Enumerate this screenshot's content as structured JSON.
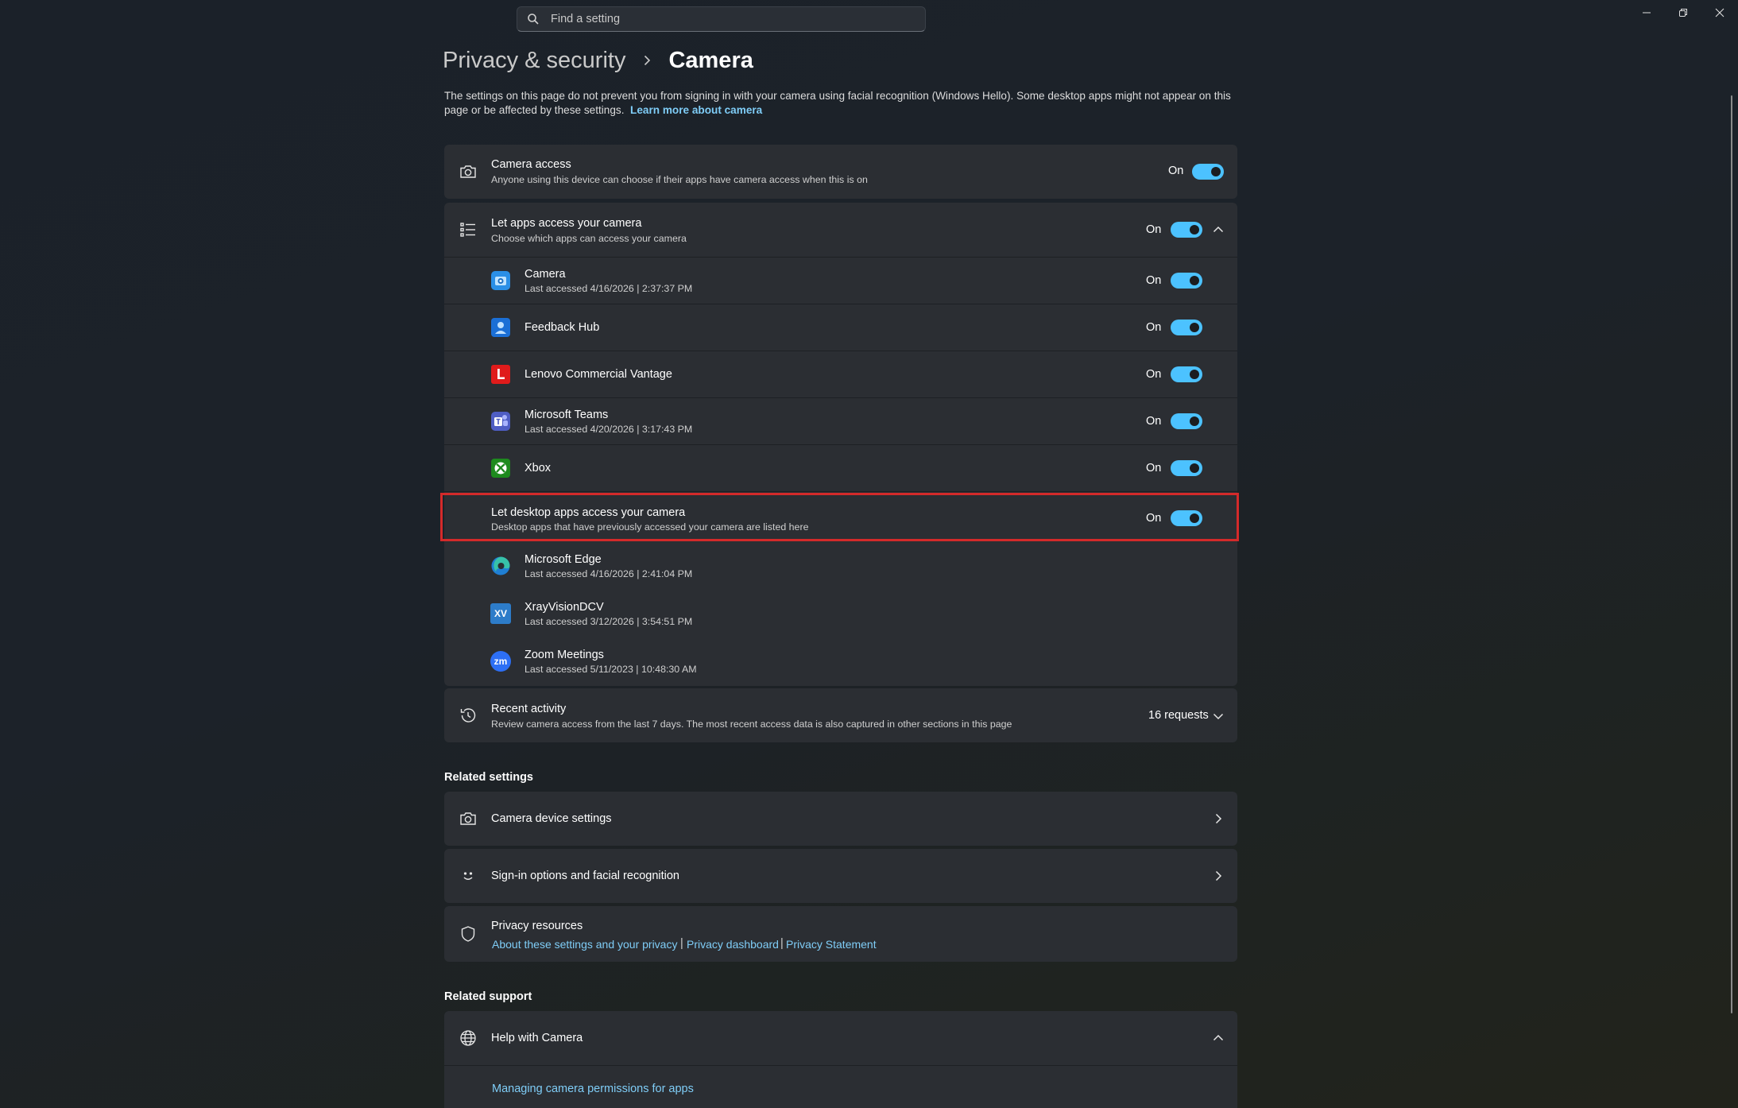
{
  "search": {
    "placeholder": "Find a setting"
  },
  "breadcrumb": {
    "parent": "Privacy & security",
    "current": "Camera"
  },
  "intro": {
    "text": "The settings on this page do not prevent you from signing in with your camera using facial recognition (Windows Hello). Some desktop apps might not appear on this page or be affected by these settings.",
    "link": "Learn more about camera"
  },
  "camera_access": {
    "title": "Camera access",
    "description": "Anyone using this device can choose if their apps have camera access when this is on",
    "state": "On"
  },
  "let_apps": {
    "title": "Let apps access your camera",
    "description": "Choose which apps can access your camera",
    "state": "On",
    "apps": [
      {
        "name": "Camera",
        "last": "Last accessed 4/16/2026  |  2:37:37 PM",
        "state": "On",
        "icon": "camera-app-icon"
      },
      {
        "name": "Feedback Hub",
        "last": "",
        "state": "On",
        "icon": "feedback-hub-icon"
      },
      {
        "name": "Lenovo Commercial Vantage",
        "last": "",
        "state": "On",
        "icon": "lenovo-vantage-icon"
      },
      {
        "name": "Microsoft Teams",
        "last": "Last accessed 4/20/2026  |  3:17:43 PM",
        "state": "On",
        "icon": "teams-icon"
      },
      {
        "name": "Xbox",
        "last": "",
        "state": "On",
        "icon": "xbox-icon"
      }
    ]
  },
  "desktop_apps": {
    "title": "Let desktop apps access your camera",
    "description": "Desktop apps that have previously accessed your camera are listed here",
    "state": "On",
    "apps": [
      {
        "name": "Microsoft Edge",
        "last": "Last accessed 4/16/2026  |  2:41:04 PM",
        "icon": "edge-icon"
      },
      {
        "name": "XrayVisionDCV",
        "last": "Last accessed 3/12/2026  |  3:54:51 PM",
        "icon": "xrayvision-icon",
        "icon_text": "XV"
      },
      {
        "name": "Zoom Meetings",
        "last": "Last accessed 5/11/2023  |  10:48:30 AM",
        "icon": "zoom-icon",
        "icon_text": "zm"
      }
    ]
  },
  "recent_activity": {
    "title": "Recent activity",
    "description": "Review camera access from the last 7 days. The most recent access data is also captured in other sections in this page",
    "count": "16 requests"
  },
  "related_settings": {
    "heading": "Related settings",
    "items": [
      {
        "label": "Camera device settings"
      },
      {
        "label": "Sign-in options and facial recognition"
      }
    ],
    "privacy": {
      "title": "Privacy resources",
      "links": [
        "About these settings and your privacy",
        "Privacy dashboard",
        "Privacy Statement"
      ],
      "separator": "|"
    }
  },
  "related_support": {
    "heading": "Related support",
    "help_title": "Help with Camera",
    "links": [
      "Managing camera permissions for apps"
    ]
  },
  "colors": {
    "accent": "#4cc2ff",
    "link": "#7fcdf7",
    "highlight": "#d42a2a"
  }
}
